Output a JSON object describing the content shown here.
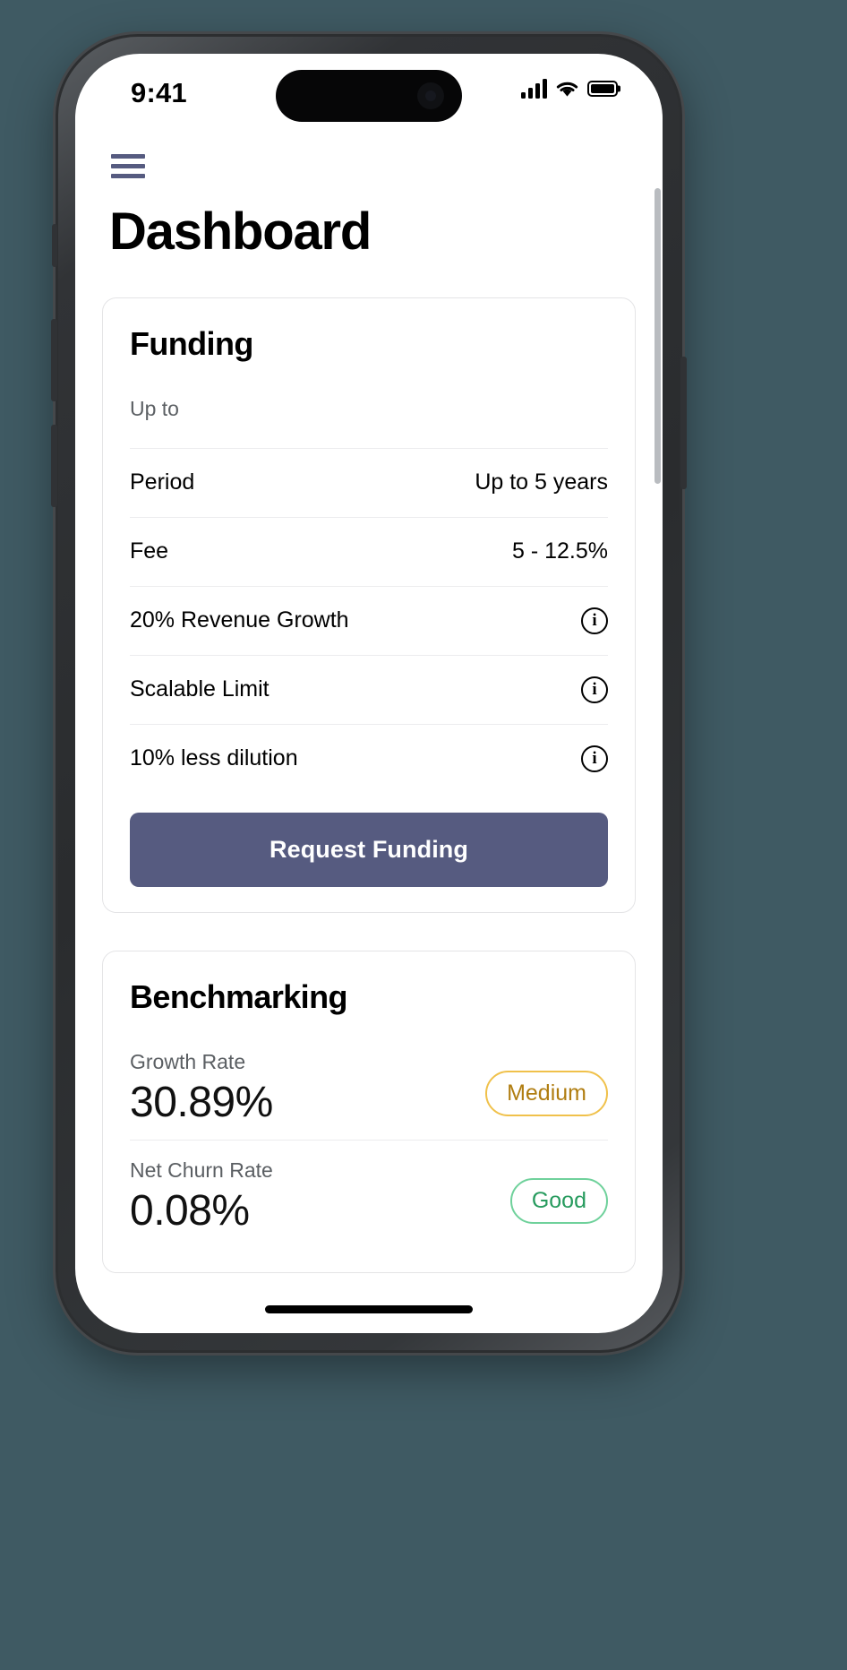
{
  "status_bar": {
    "time": "9:41",
    "signal_icon": "cellular-signal-icon",
    "wifi_icon": "wifi-icon",
    "battery_icon": "battery-full-icon"
  },
  "header": {
    "menu_icon": "hamburger-menu-icon",
    "title": "Dashboard"
  },
  "funding_card": {
    "title": "Funding",
    "amount_label": "Up to",
    "amount_value": "",
    "rows": [
      {
        "label": "Period",
        "value": "Up to 5 years",
        "has_info": false
      },
      {
        "label": "Fee",
        "value": "5 - 12.5%",
        "has_info": false
      },
      {
        "label": "20% Revenue Growth",
        "value": "",
        "has_info": true,
        "info_glyph": "i"
      },
      {
        "label": "Scalable Limit",
        "value": "",
        "has_info": true,
        "info_glyph": "i"
      },
      {
        "label": "10% less dilution",
        "value": "",
        "has_info": true,
        "info_glyph": "i"
      }
    ],
    "cta_label": "Request Funding",
    "cta_color": "#565b80"
  },
  "benchmarking_card": {
    "title": "Benchmarking",
    "metrics": [
      {
        "name": "Growth Rate",
        "value": "30.89%",
        "badge": "Medium",
        "badge_text_color": "#b07d10",
        "badge_border_color": "#f0c14b"
      },
      {
        "name": "Net Churn Rate",
        "value": "0.08%",
        "badge": "Good",
        "badge_text_color": "#279b5e",
        "badge_border_color": "#6fd19b"
      }
    ]
  },
  "theme": {
    "background": "#3f5a63",
    "accent": "#565b80",
    "card_border": "#e4e4e6"
  }
}
